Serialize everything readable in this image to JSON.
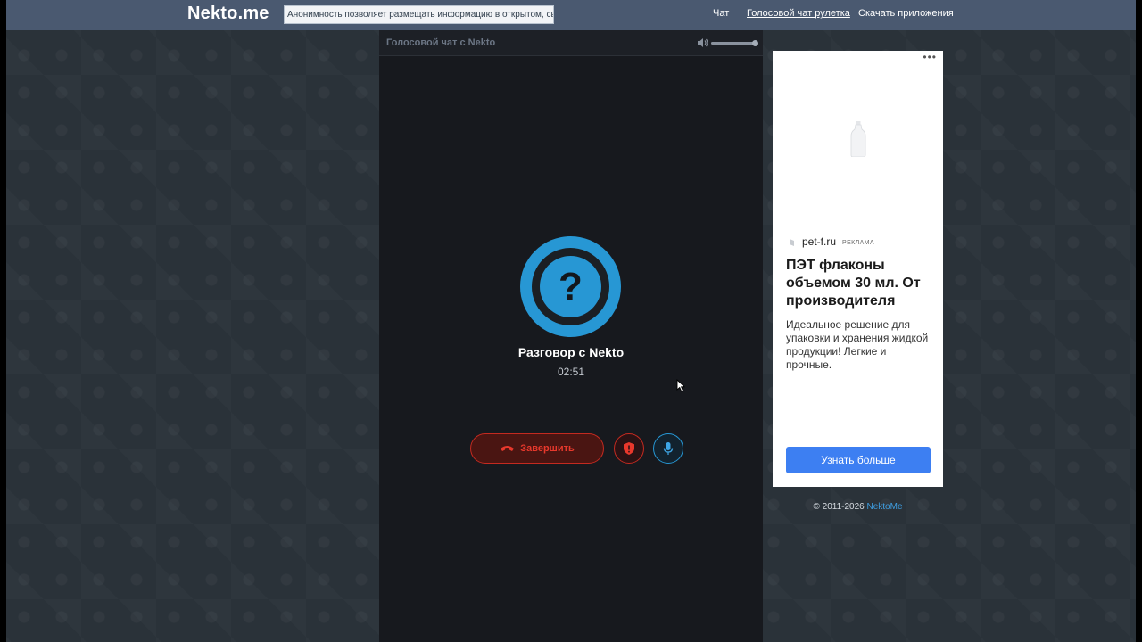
{
  "header": {
    "logo": "Nekto.me",
    "slogan": "Анонимность позволяет размещать информацию в открытом, сыром виде!",
    "nav": [
      {
        "label": "Чат",
        "active": false
      },
      {
        "label": "Голосовой чат рулетка",
        "active": true
      },
      {
        "label": "Скачать приложения",
        "active": false
      }
    ]
  },
  "chat": {
    "title": "Голосовой чат с Nekto",
    "volume_level": 0.95,
    "avatar_icon": "question-mark-icon",
    "avatar_symbol": "?",
    "call_name": "Разговор с Nekto",
    "timer": "02:51",
    "end_label": "Завершить",
    "report_icon": "shield-exclamation-icon",
    "mic_icon": "microphone-icon"
  },
  "ad": {
    "menu": "•••",
    "domain": "pet-f.ru",
    "tag": "РЕКЛАМА",
    "title": "ПЭТ флаконы объемом 30 мл. От производителя",
    "text": "Идеальное решение для упаковки и хранения жидкой продукции! Легкие и прочные.",
    "cta": "Узнать больше"
  },
  "footer": {
    "copyright": "© 2011-2026",
    "brand": "NektoMe"
  },
  "colors": {
    "accent_blue": "#2797d4",
    "danger_red": "#e8382c",
    "header_bg": "#4a5970",
    "panel_bg": "#17191e",
    "ad_button": "#3d7ff2"
  }
}
